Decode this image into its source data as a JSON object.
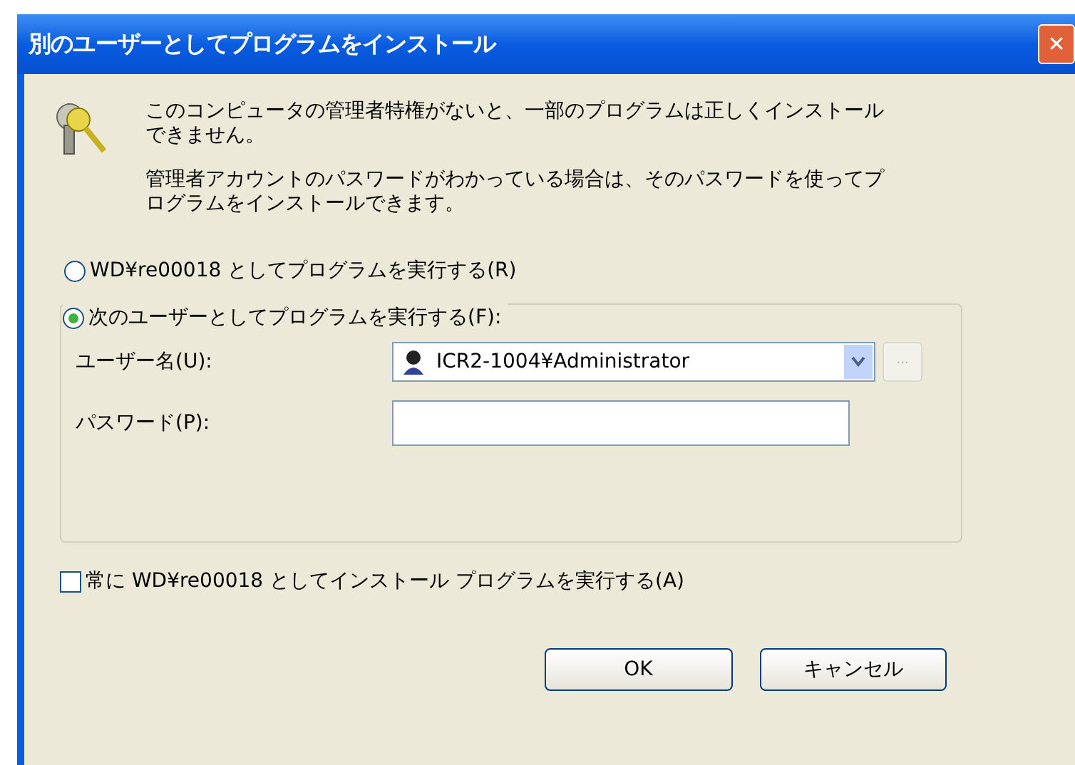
{
  "window": {
    "title": "別のユーザーとしてプログラムをインストール",
    "close": "✕"
  },
  "messages": [
    "このコンピュータの管理者特権がないと、一部のプログラムは正しくインストールできません。",
    "管理者アカウントのパスワードがわかっている場合は、そのパスワードを使ってプログラムをインストールできます。"
  ],
  "options": [
    {
      "label": "WD¥re00018 としてプログラムを実行する(R)",
      "selected": false
    },
    {
      "label": "次のユーザーとしてプログラムを実行する(F):",
      "selected": true
    }
  ],
  "user_name": {
    "label": "ユーザー名(U):",
    "value": "ICR2-1004¥Administrator",
    "browse": "..."
  },
  "password": {
    "label": "パスワード(P):"
  },
  "always": {
    "label": "常に WD¥re00018 としてインストール プログラムを実行する(A)",
    "checked": false
  },
  "buttons": [
    "OK",
    "キャンセル"
  ]
}
